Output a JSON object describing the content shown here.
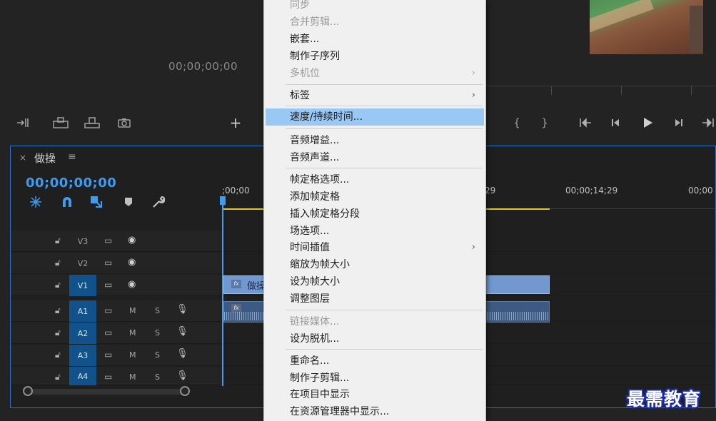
{
  "monitor": {
    "timecode": "00;00;00;00",
    "toolbar_icons": [
      "insert-icon",
      "overwrite-icon",
      "export-frame-icon",
      "camera-icon",
      "plus-icon",
      "mark-in-icon",
      "mark-out-icon",
      "go-to-in-icon",
      "step-back-icon",
      "play-icon",
      "step-forward-icon",
      "go-to-out-icon"
    ]
  },
  "timeline": {
    "tab_title": "做操",
    "close_glyph": "×",
    "menu_glyph": "≡",
    "timecode": "00;00;00;00",
    "ruler": {
      "label_start": ";00;00",
      "label_mid": "29",
      "label_1429": "00;00;14;29",
      "label_end": "00;00"
    },
    "tracks": {
      "v3": "V3",
      "v2": "V2",
      "v1": "V1",
      "a1": "A1",
      "a2": "A2",
      "a3": "A3",
      "a4": "A4",
      "mute": "M",
      "solo": "S"
    },
    "clip_video_name": "做操",
    "clip_fx": "fx"
  },
  "context_menu": {
    "items": [
      {
        "label": "同步",
        "disabled": true
      },
      {
        "label": "合并剪辑...",
        "disabled": true
      },
      {
        "label": "嵌套...",
        "disabled": false
      },
      {
        "label": "制作子序列",
        "disabled": false
      },
      {
        "label": "多机位",
        "disabled": true,
        "submenu": true
      },
      {
        "label": "标签",
        "disabled": false,
        "submenu": true
      },
      {
        "label": "速度/持续时间...",
        "disabled": false,
        "highlighted": true
      },
      {
        "label": "音频增益...",
        "disabled": false
      },
      {
        "label": "音频声道...",
        "disabled": false
      },
      {
        "label": "帧定格选项...",
        "disabled": false
      },
      {
        "label": "添加帧定格",
        "disabled": false
      },
      {
        "label": "插入帧定格分段",
        "disabled": false
      },
      {
        "label": "场选项...",
        "disabled": false
      },
      {
        "label": "时间插值",
        "disabled": false,
        "submenu": true
      },
      {
        "label": "缩放为帧大小",
        "disabled": false
      },
      {
        "label": "设为帧大小",
        "disabled": false
      },
      {
        "label": "调整图层",
        "disabled": false
      },
      {
        "label": "链接媒体...",
        "disabled": true
      },
      {
        "label": "设为脱机...",
        "disabled": false
      },
      {
        "label": "重命名...",
        "disabled": false
      },
      {
        "label": "制作子剪辑...",
        "disabled": false
      },
      {
        "label": "在项目中显示",
        "disabled": false
      },
      {
        "label": "在资源管理器中显示...",
        "disabled": false
      }
    ],
    "submenu_arrow": "›"
  },
  "watermark": "最需教育",
  "colors": {
    "accent_blue": "#3d9cf0",
    "menu_highlight": "#99c8f4",
    "track_selected": "#11528b",
    "video_clip": "#7199d0",
    "audio_clip": "#3d5a82",
    "work_area": "#d9c92a"
  }
}
